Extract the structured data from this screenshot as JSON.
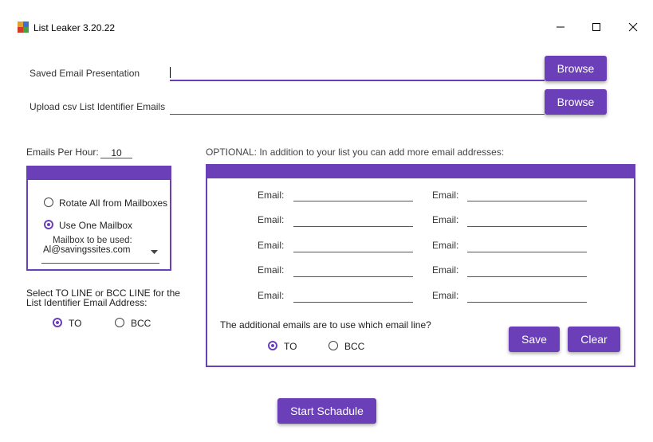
{
  "window": {
    "title": "List Leaker 3.20.22",
    "minimize_glyph": "—",
    "maximize_glyph": "☐",
    "close_glyph": "✕"
  },
  "files": {
    "saved_email_label": "Saved Email Presentation",
    "saved_email_value": "",
    "upload_csv_label": "Upload csv List Identifier Emails",
    "upload_csv_value": "",
    "browse_label": "Browse"
  },
  "rate": {
    "label": "Emails Per Hour:",
    "value": "10"
  },
  "mailbox": {
    "rotate_label": "Rotate All from Mailboxes",
    "rotate_checked": false,
    "one_label": "Use One Mailbox",
    "one_checked": true,
    "select_label": "Mailbox to be used:",
    "selected_value": "Al@savingssites.com"
  },
  "line_select": {
    "label_line1": "Select TO LINE or BCC LINE for the",
    "label_line2": "List Identifier Email Address:",
    "to_label": "TO",
    "to_checked": true,
    "bcc_label": "BCC",
    "bcc_checked": false
  },
  "optional": {
    "header": "OPTIONAL: In addition to your list you can add more email addresses:",
    "email_label": "Email:",
    "rows": 5,
    "question": "The additional emails are to use which email line?",
    "to_label": "TO",
    "to_checked": true,
    "bcc_label": "BCC",
    "bcc_checked": false,
    "save_label": "Save",
    "clear_label": "Clear"
  },
  "start_label": "Start Schadule",
  "colors": {
    "accent": "#6b3fb8"
  }
}
